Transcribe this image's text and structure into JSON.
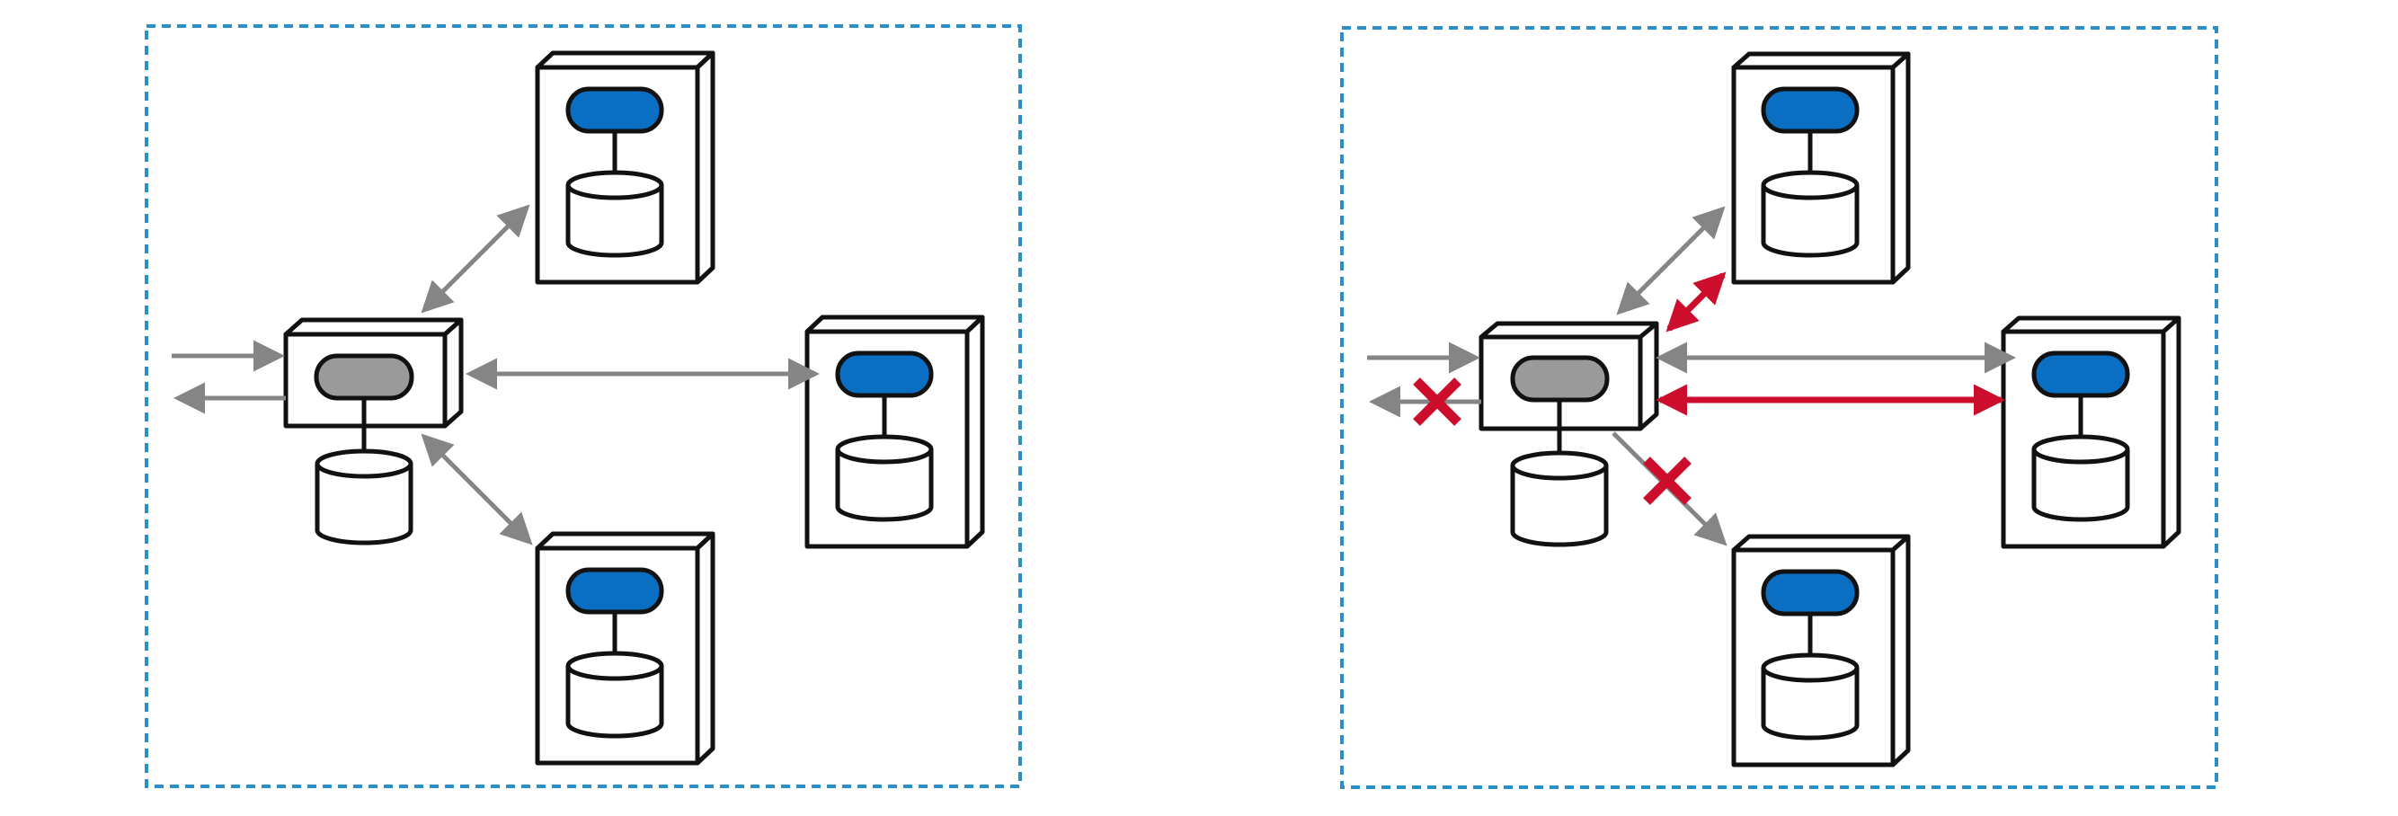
{
  "colors": {
    "background": "#ffffff",
    "boundary": "#2a8fc9",
    "node_outline": "#111111",
    "node_fill": "#ffffff",
    "worker_pill": "#0a6fc2",
    "coordinator_pill": "#9a9a9a",
    "link": "#858585",
    "failure": "#cc0e2c"
  },
  "diagrams": [
    {
      "id": "left",
      "coordinator": {
        "pill": "gray",
        "has_database": true
      },
      "workers": [
        {
          "id": "top",
          "pill": "blue",
          "has_database": true
        },
        {
          "id": "right",
          "pill": "blue",
          "has_database": true
        },
        {
          "id": "bottom",
          "pill": "blue",
          "has_database": true
        }
      ],
      "links": [
        {
          "from": "client",
          "to": "coordinator",
          "style": "gray-one-way-in"
        },
        {
          "from": "coordinator",
          "to": "client",
          "style": "gray-one-way-out"
        },
        {
          "from": "coordinator",
          "to": "top",
          "style": "gray-bidirectional"
        },
        {
          "from": "coordinator",
          "to": "right",
          "style": "gray-bidirectional"
        },
        {
          "from": "coordinator",
          "to": "bottom",
          "style": "gray-bidirectional"
        }
      ],
      "failures": []
    },
    {
      "id": "right",
      "coordinator": {
        "pill": "gray",
        "has_database": true
      },
      "workers": [
        {
          "id": "top",
          "pill": "blue",
          "has_database": true
        },
        {
          "id": "right",
          "pill": "blue",
          "has_database": true
        },
        {
          "id": "bottom",
          "pill": "blue",
          "has_database": true
        }
      ],
      "links": [
        {
          "from": "client",
          "to": "coordinator",
          "style": "gray-one-way-in"
        },
        {
          "from": "coordinator",
          "to": "client",
          "style": "gray-one-way-out-broken"
        },
        {
          "from": "coordinator",
          "to": "top",
          "style": "gray-bidirectional"
        },
        {
          "from": "coordinator",
          "to": "top",
          "style": "red-bidirectional"
        },
        {
          "from": "coordinator",
          "to": "right",
          "style": "gray-one-way"
        },
        {
          "from": "coordinator",
          "to": "right",
          "style": "red-bidirectional"
        },
        {
          "from": "coordinator",
          "to": "bottom",
          "style": "gray-one-way-broken"
        }
      ],
      "failures": [
        {
          "on": "client-response",
          "mark": "red-x"
        },
        {
          "on": "coordinator-to-bottom",
          "mark": "red-x"
        }
      ]
    }
  ]
}
